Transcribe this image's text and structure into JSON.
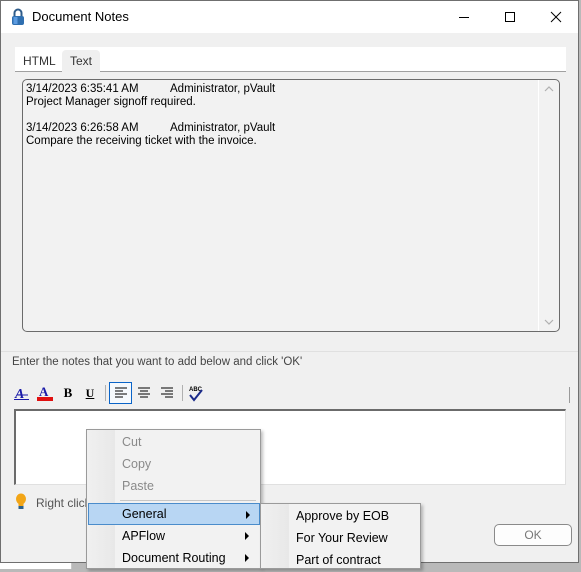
{
  "window": {
    "title": "Document Notes",
    "icon": "padlock-icon",
    "controls": {
      "minimize": "minimize-icon",
      "maximize": "maximize-icon",
      "close": "close-icon"
    }
  },
  "tabs": [
    {
      "label": "HTML",
      "active": false
    },
    {
      "label": "Text",
      "active": true
    }
  ],
  "history": {
    "notes": [
      {
        "date": "3/14/2023 6:35:41 AM",
        "author": "Administrator, pVault",
        "text": "Project Manager signoff required."
      },
      {
        "date": "3/14/2023 6:26:58 AM",
        "author": "Administrator, pVault",
        "text": "Compare the receiving ticket with the invoice."
      }
    ],
    "scroll_up": "˄",
    "scroll_down": "˅"
  },
  "instructions": "Enter the notes that you want to add below and click 'OK'",
  "toolbar": {
    "buttons": [
      {
        "name": "font",
        "icon": "font-icon"
      },
      {
        "name": "font-color",
        "icon": "font-color-icon",
        "color": "#e01010"
      },
      {
        "name": "bold",
        "label": "B",
        "icon": "bold-icon"
      },
      {
        "name": "underline",
        "label": "U",
        "icon": "underline-icon"
      },
      {
        "name": "align-left",
        "icon": "align-left-icon",
        "active": true
      },
      {
        "name": "align-center",
        "icon": "align-center-icon"
      },
      {
        "name": "align-right",
        "icon": "align-right-icon"
      },
      {
        "name": "spell-check",
        "label": "ABC",
        "icon": "spellcheck-icon"
      }
    ]
  },
  "editor": {
    "value": ""
  },
  "hint": {
    "icon": "lightbulb-icon",
    "text": "Right click"
  },
  "ok_label": "OK",
  "context_menu": {
    "items": [
      {
        "label": "Cut",
        "disabled": true
      },
      {
        "label": "Copy",
        "disabled": true
      },
      {
        "label": "Paste",
        "disabled": true
      },
      {
        "label": "General",
        "submenu": true,
        "highlighted": true
      },
      {
        "label": "APFlow",
        "submenu": true
      },
      {
        "label": "Document Routing",
        "submenu": true
      }
    ]
  },
  "submenu": {
    "items": [
      {
        "label": "Approve by EOB"
      },
      {
        "label": "For Your Review"
      },
      {
        "label": "Part of contract"
      }
    ]
  },
  "colors": {
    "accent": "#0a64c8",
    "highlight": "#b8d6f3",
    "font_color_bar": "#e01010",
    "font_icon_blue": "#1a1aa8",
    "lightbulb": "#f2a516"
  }
}
